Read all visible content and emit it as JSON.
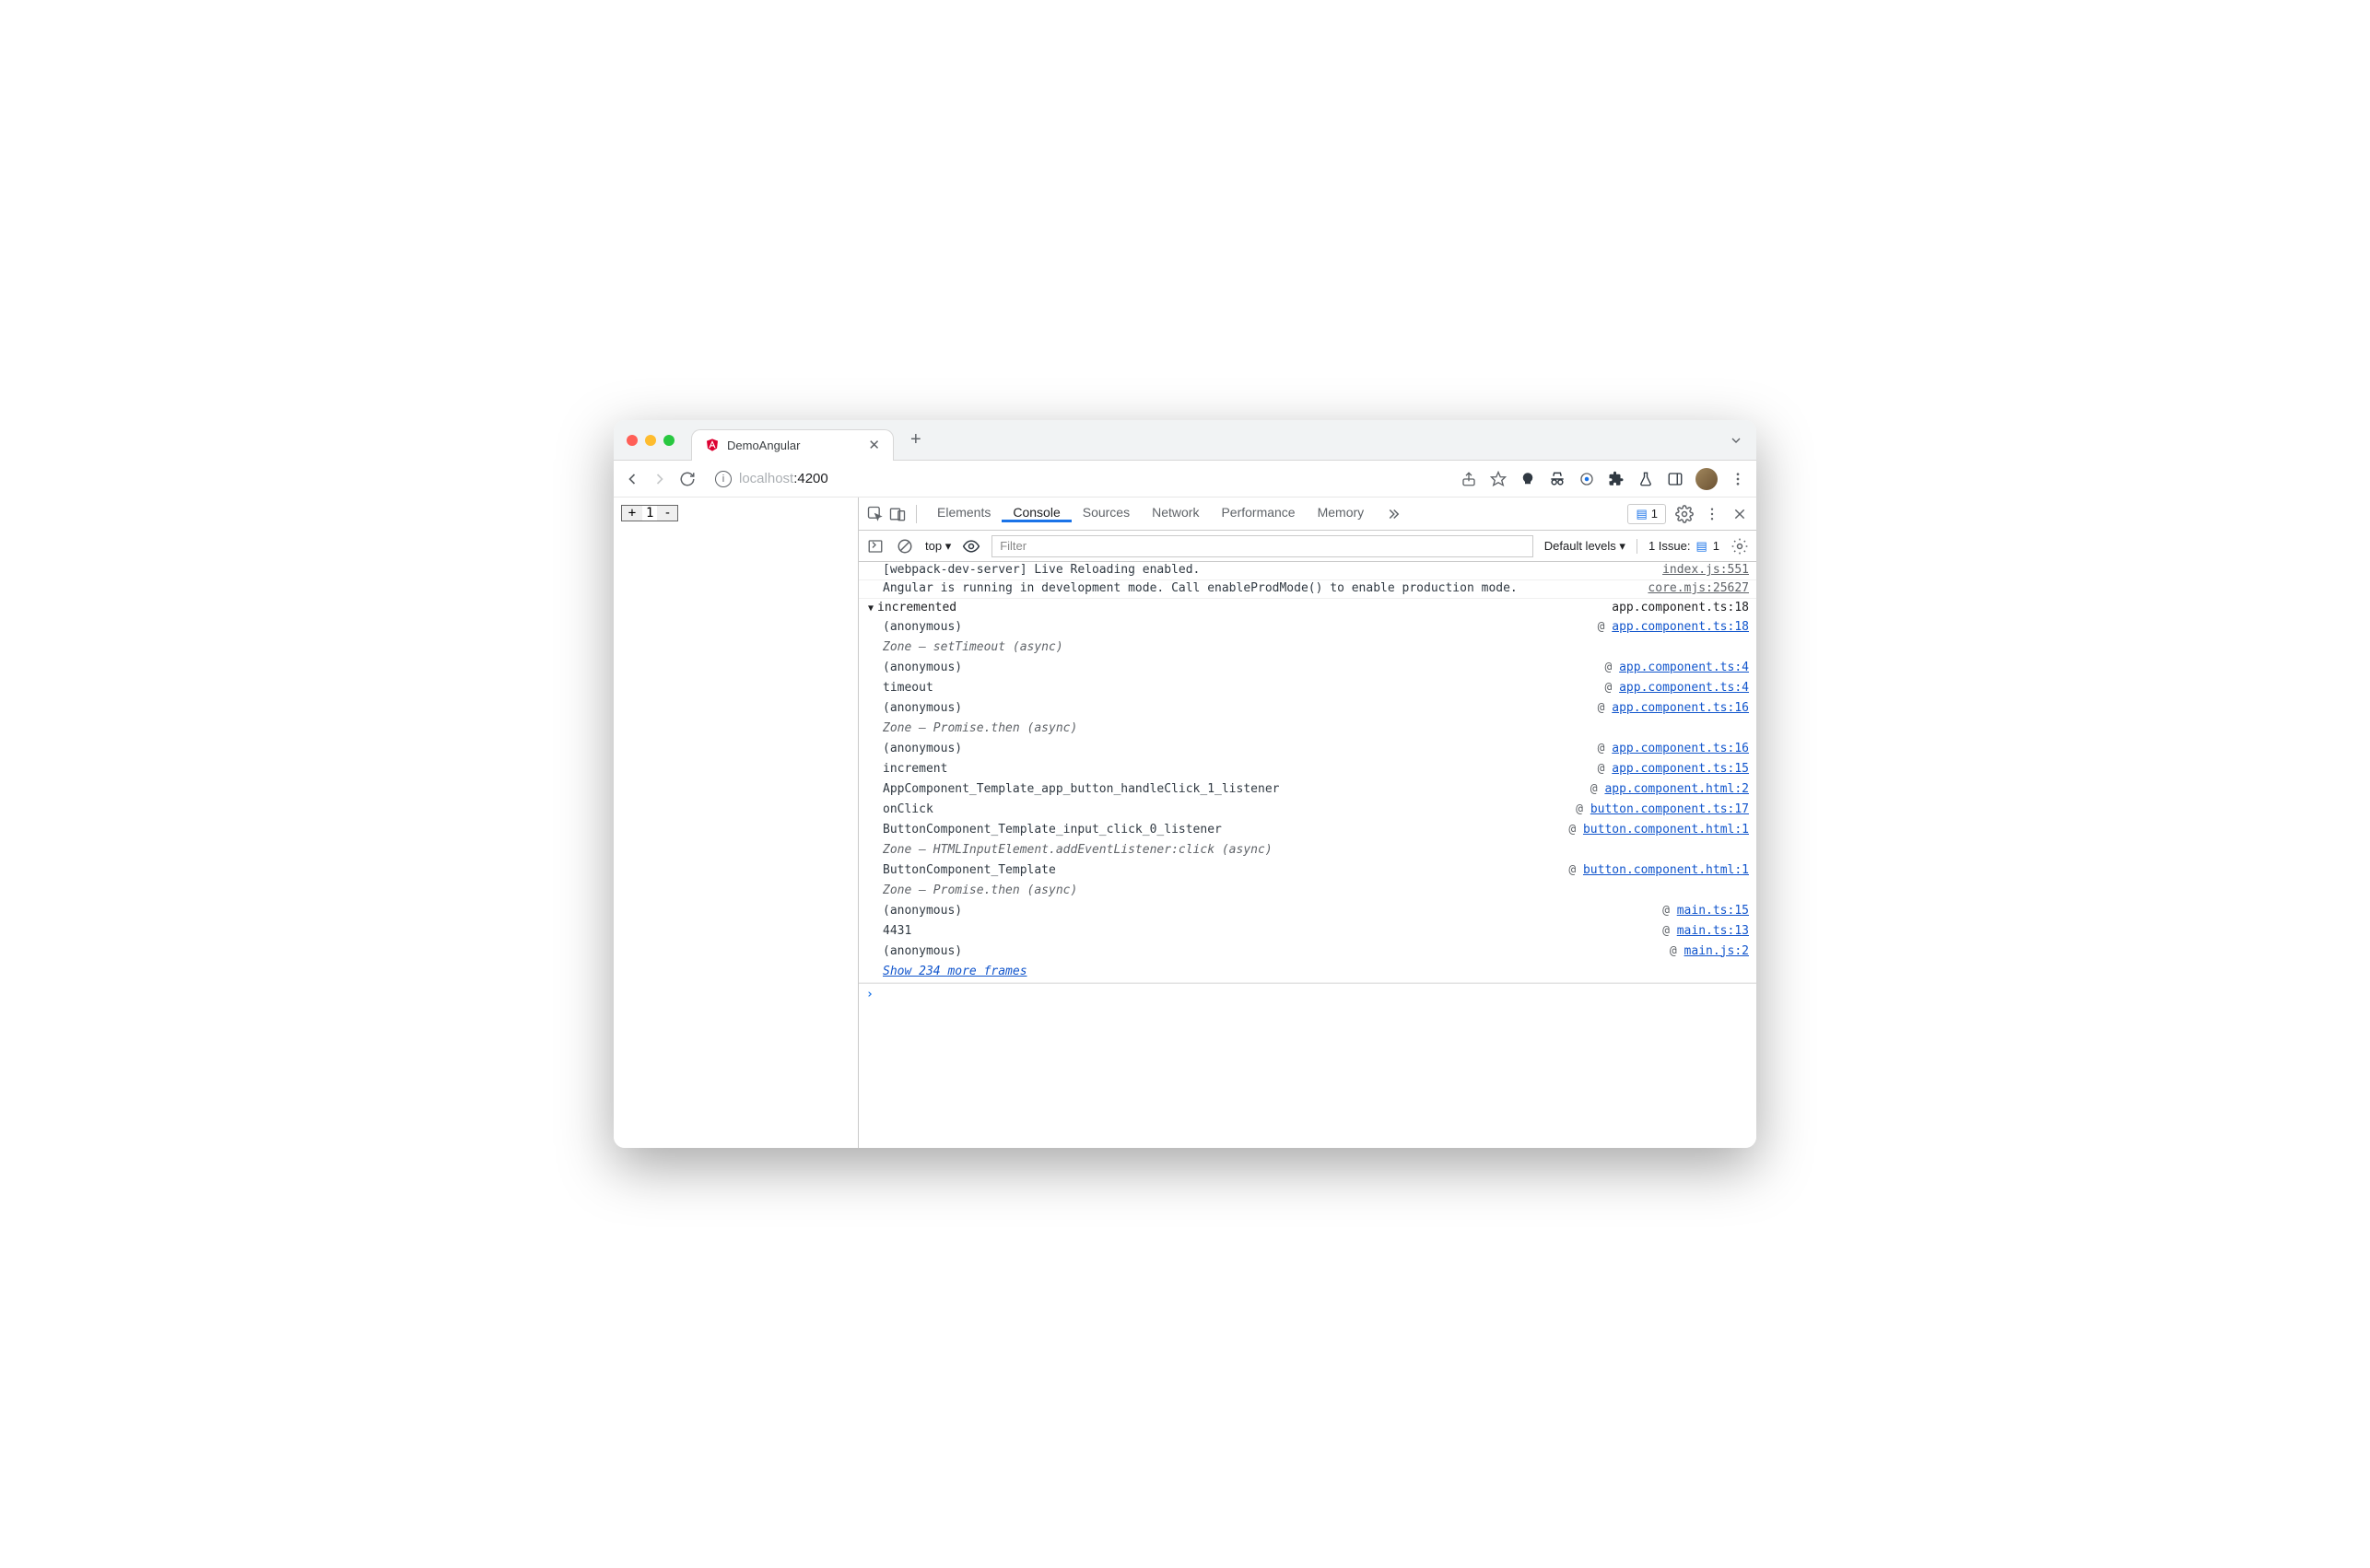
{
  "tab": {
    "title": "DemoAngular"
  },
  "url": {
    "host": "localhost",
    "port": ":4200"
  },
  "page": {
    "counter_value": "1",
    "plus": "+",
    "minus": "-"
  },
  "devtools": {
    "tabs": [
      "Elements",
      "Console",
      "Sources",
      "Network",
      "Performance",
      "Memory"
    ],
    "active_tab": "Console",
    "chat_count": "1",
    "context": "top",
    "filter_placeholder": "Filter",
    "levels": "Default levels",
    "issues_label": "1 Issue:",
    "issues_count": "1",
    "log": [
      {
        "msg": "[webpack-dev-server] Live Reloading enabled.",
        "src": "index.js:551"
      },
      {
        "msg": "Angular is running in development mode. Call enableProdMode() to enable production mode.",
        "src": "core.mjs:25627"
      }
    ],
    "trace": {
      "label": "incremented",
      "src": "app.component.ts:18",
      "frames": [
        {
          "fn": "(anonymous)",
          "loc": "app.component.ts:18"
        },
        {
          "fn": "Zone — setTimeout (async)",
          "zone": true
        },
        {
          "fn": "(anonymous)",
          "loc": "app.component.ts:4"
        },
        {
          "fn": "timeout",
          "loc": "app.component.ts:4"
        },
        {
          "fn": "(anonymous)",
          "loc": "app.component.ts:16"
        },
        {
          "fn": "Zone — Promise.then (async)",
          "zone": true
        },
        {
          "fn": "(anonymous)",
          "loc": "app.component.ts:16"
        },
        {
          "fn": "increment",
          "loc": "app.component.ts:15"
        },
        {
          "fn": "AppComponent_Template_app_button_handleClick_1_listener",
          "loc": "app.component.html:2"
        },
        {
          "fn": "onClick",
          "loc": "button.component.ts:17"
        },
        {
          "fn": "ButtonComponent_Template_input_click_0_listener",
          "loc": "button.component.html:1"
        },
        {
          "fn": "Zone — HTMLInputElement.addEventListener:click (async)",
          "zone": true
        },
        {
          "fn": "ButtonComponent_Template",
          "loc": "button.component.html:1"
        },
        {
          "fn": "Zone — Promise.then (async)",
          "zone": true
        },
        {
          "fn": "(anonymous)",
          "loc": "main.ts:15"
        },
        {
          "fn": "4431",
          "loc": "main.ts:13"
        },
        {
          "fn": "(anonymous)",
          "loc": "main.js:2"
        }
      ],
      "more": "Show 234 more frames"
    }
  }
}
